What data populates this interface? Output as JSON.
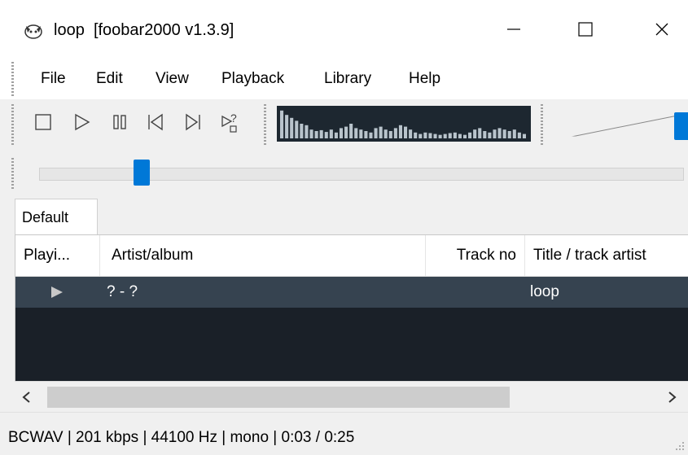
{
  "window": {
    "title": "loop",
    "app": "[foobar2000 v1.3.9]",
    "controls": [
      "minimize",
      "maximize",
      "close"
    ]
  },
  "menu": [
    "File",
    "Edit",
    "View",
    "Playback",
    "Library",
    "Help"
  ],
  "toolbar": {
    "buttons": [
      {
        "name": "stop-button",
        "icon": "stop-icon"
      },
      {
        "name": "play-button",
        "icon": "play-icon"
      },
      {
        "name": "pause-button",
        "icon": "pause-icon"
      },
      {
        "name": "previous-button",
        "icon": "previous-icon"
      },
      {
        "name": "next-button",
        "icon": "next-icon"
      },
      {
        "name": "random-button",
        "icon": "random-icon"
      }
    ],
    "volume_level": 1.0,
    "spectrum_levels": [
      0.95,
      0.8,
      0.7,
      0.6,
      0.5,
      0.45,
      0.3,
      0.25,
      0.28,
      0.22,
      0.3,
      0.2,
      0.35,
      0.4,
      0.5,
      0.35,
      0.3,
      0.25,
      0.2,
      0.35,
      0.4,
      0.3,
      0.25,
      0.35,
      0.45,
      0.4,
      0.3,
      0.2,
      0.15,
      0.2,
      0.18,
      0.15,
      0.12,
      0.15,
      0.18,
      0.2,
      0.15,
      0.12,
      0.2,
      0.3,
      0.35,
      0.25,
      0.2,
      0.3,
      0.35,
      0.3,
      0.25,
      0.3,
      0.2,
      0.15
    ]
  },
  "seek": {
    "position_fraction": 0.16
  },
  "tabs": [
    "Default"
  ],
  "playlist": {
    "columns": [
      "Playi...",
      "Artist/album",
      "Track no",
      "Title / track artist"
    ],
    "rows": [
      {
        "playing_icon": "play-arrow-icon",
        "artist_album": "? - ?",
        "track_no": "",
        "title": "loop"
      }
    ]
  },
  "colors": {
    "accent": "#0078d7",
    "playlist_bg": "#1a2028",
    "row_bg": "#364350"
  },
  "status": "BCWAV | 201 kbps | 44100 Hz | mono | 0:03 / 0:25"
}
